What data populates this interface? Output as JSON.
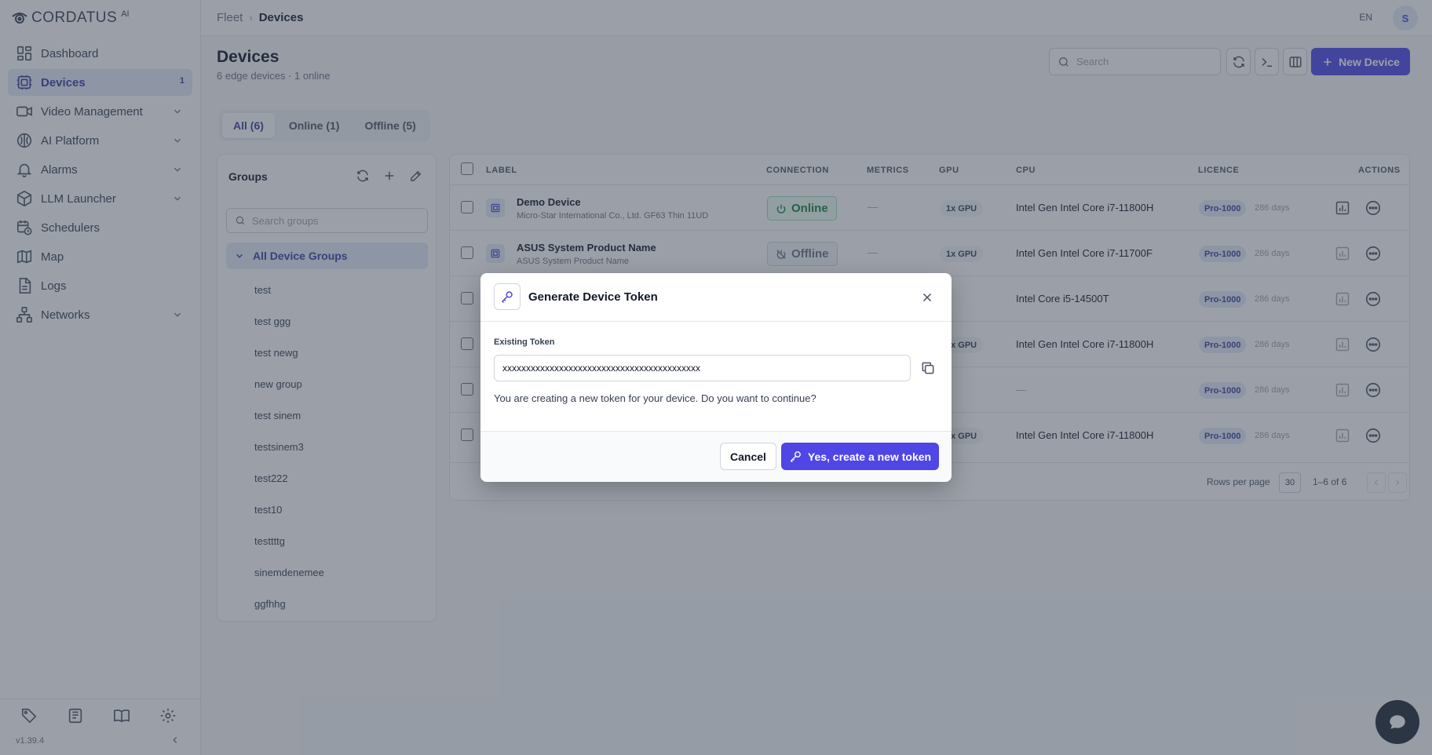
{
  "brand": {
    "name": "CORDATUS",
    "sup": "AI"
  },
  "sidebar": {
    "items": [
      {
        "label": "Dashboard",
        "icon": "dashboard-icon",
        "expandable": false
      },
      {
        "label": "Devices",
        "icon": "devices-icon",
        "active": true,
        "badge": "1"
      },
      {
        "label": "Video Management",
        "icon": "video-icon",
        "expandable": true
      },
      {
        "label": "AI Platform",
        "icon": "brain-icon",
        "expandable": true
      },
      {
        "label": "Alarms",
        "icon": "bell-icon",
        "expandable": true
      },
      {
        "label": "LLM Launcher",
        "icon": "cube-icon",
        "expandable": true
      },
      {
        "label": "Schedulers",
        "icon": "calendar-clock-icon",
        "expandable": false
      },
      {
        "label": "Map",
        "icon": "map-icon",
        "expandable": false
      },
      {
        "label": "Logs",
        "icon": "file-icon",
        "expandable": false
      },
      {
        "label": "Networks",
        "icon": "network-icon",
        "expandable": true
      }
    ],
    "version": "v1.39.4"
  },
  "header": {
    "breadcrumb": {
      "parent": "Fleet",
      "current": "Devices"
    },
    "lang": "EN",
    "avatar": "S"
  },
  "page": {
    "title": "Devices",
    "subtitle": "6 edge devices · 1 online",
    "search_placeholder": "Search",
    "new_device_label": "New Device"
  },
  "tabs": [
    {
      "label": "All (6)",
      "active": true
    },
    {
      "label": "Online (1)"
    },
    {
      "label": "Offline (5)"
    }
  ],
  "groups": {
    "title": "Groups",
    "search_placeholder": "Search groups",
    "all_label": "All Device Groups",
    "items": [
      "test",
      "test ggg",
      "test newg",
      "new group",
      "test sinem",
      "testsinem3",
      "test222",
      "test10",
      "testtttg",
      "sinemdenemee",
      "ggfhhg"
    ]
  },
  "table": {
    "headers": {
      "label": "LABEL",
      "connection": "CONNECTION",
      "metrics": "METRICS",
      "gpu": "GPU",
      "cpu": "CPU",
      "licence": "LICENCE",
      "actions": "ACTIONS"
    },
    "rows": [
      {
        "name": "Demo Device",
        "sub": "Micro-Star International Co., Ltd. GF63 Thin 11UD",
        "connection": "Online",
        "online": true,
        "metrics": "—",
        "gpu": "1x GPU",
        "cpu": "Intel Gen Intel Core i7-11800H",
        "licence": "Pro-1000",
        "days": "286 days"
      },
      {
        "name": "ASUS System Product Name",
        "sub": "ASUS System Product Name",
        "connection": "Offline",
        "online": false,
        "metrics": "—",
        "gpu": "1x GPU",
        "cpu": "Intel Gen Intel Core i7-11700F",
        "licence": "Pro-1000",
        "days": "286 days"
      },
      {
        "name": "",
        "sub": "",
        "connection": "",
        "metrics": "",
        "gpu": "",
        "cpu": "Intel Core i5-14500T",
        "licence": "Pro-1000",
        "days": "286 days"
      },
      {
        "name": "",
        "sub": "",
        "connection": "",
        "metrics": "",
        "gpu": "1x GPU",
        "cpu": "Intel Gen Intel Core i7-11800H",
        "licence": "Pro-1000",
        "days": "286 days"
      },
      {
        "name": "",
        "sub": "",
        "connection": "",
        "metrics": "",
        "gpu": "",
        "cpu": "—",
        "licence": "Pro-1000",
        "days": "286 days"
      },
      {
        "name": "",
        "sub": "",
        "connection": "",
        "metrics": "",
        "gpu": "1x GPU",
        "cpu": "Intel Gen Intel Core i7-11800H",
        "licence": "Pro-1000",
        "days": "286 days"
      }
    ],
    "footer": {
      "rows_per_page_label": "Rows per page",
      "rows_per_page": "30",
      "range": "1–6 of 6"
    }
  },
  "modal": {
    "title": "Generate Device Token",
    "existing_label": "Existing Token",
    "token": "xxxxxxxxxxxxxxxxxxxxxxxxxxxxxxxxxxxxxxxxxx",
    "message": "You are creating a new token for your device. Do you want to continue?",
    "cancel_label": "Cancel",
    "confirm_label": "Yes, create a new token"
  },
  "colors": {
    "accent": "#4f46e5",
    "online": "#15803d",
    "overlay": "#374151"
  }
}
